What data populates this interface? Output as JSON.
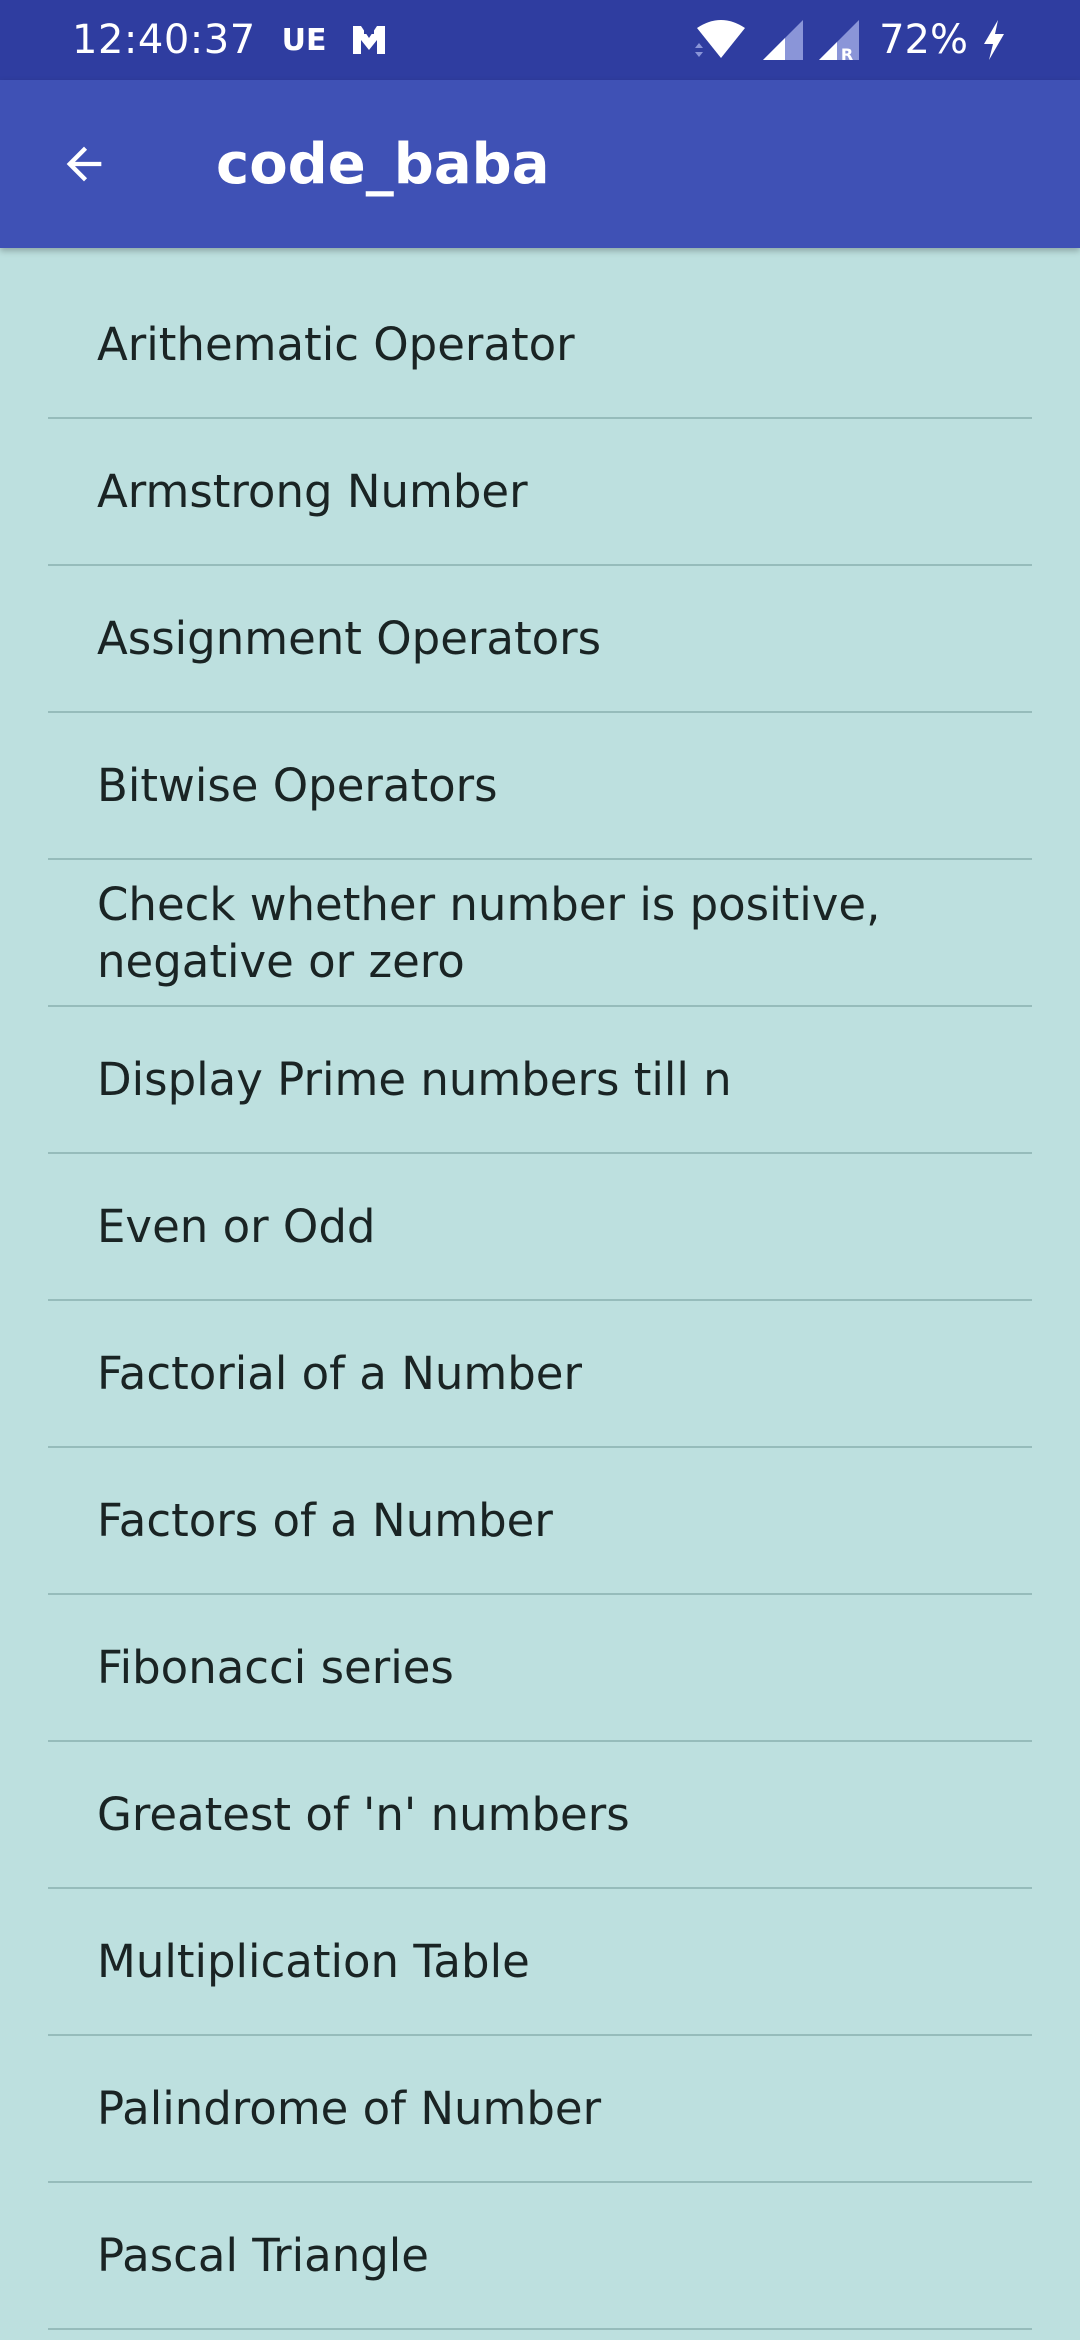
{
  "status_bar": {
    "time": "12:40:37",
    "carrier": "UE",
    "battery": "72%",
    "icons": [
      "notification-m-icon",
      "wifi-icon",
      "signal-icon",
      "signal-roaming-icon",
      "charging-icon"
    ]
  },
  "toolbar": {
    "back_icon": "arrow-back-icon",
    "title": "code_baba",
    "background": "#3f51b5",
    "status_bar_color": "#2f3da0"
  },
  "list": {
    "background": "#bde0df",
    "items": [
      {
        "label": "Arithematic Operator"
      },
      {
        "label": "Armstrong Number"
      },
      {
        "label": "Assignment Operators"
      },
      {
        "label": "Bitwise Operators"
      },
      {
        "label": "Check whether number is positive, negative or zero"
      },
      {
        "label": "Display Prime numbers till n"
      },
      {
        "label": "Even or Odd"
      },
      {
        "label": "Factorial of a Number"
      },
      {
        "label": "Factors of a Number"
      },
      {
        "label": "Fibonacci series"
      },
      {
        "label": "Greatest of 'n' numbers"
      },
      {
        "label": "Multiplication Table"
      },
      {
        "label": "Palindrome of Number"
      },
      {
        "label": "Pascal Triangle"
      }
    ]
  }
}
